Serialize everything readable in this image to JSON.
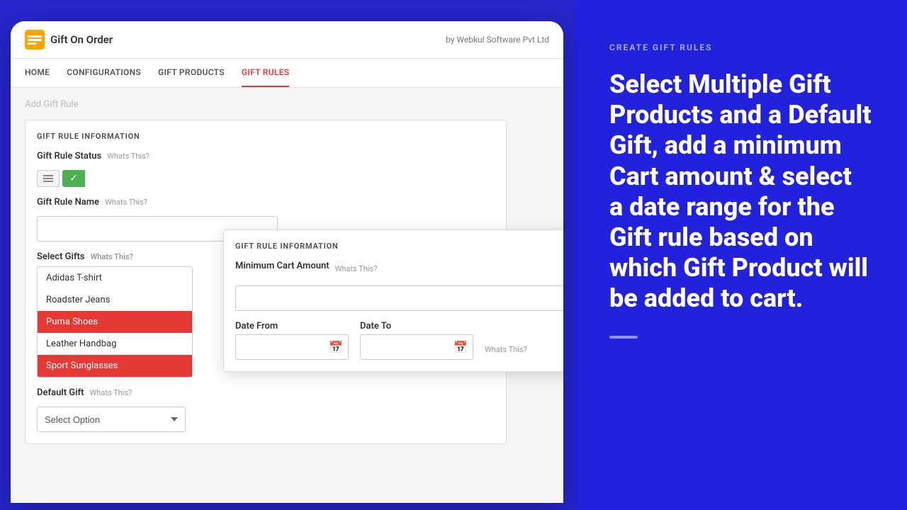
{
  "app": {
    "logo_text": "Gift On Order",
    "by_text": "by Webkul Software Pvt Ltd"
  },
  "nav": {
    "items": [
      {
        "label": "HOME",
        "active": false
      },
      {
        "label": "CONFIGURATIONS",
        "active": false
      },
      {
        "label": "GIFT PRODUCTS",
        "active": false
      },
      {
        "label": "GIFT RULES",
        "active": true
      }
    ]
  },
  "page": {
    "title": "Add Gift Rule",
    "section_title": "GIFT RULE INFORMATION",
    "gift_rule_status_label": "Gift Rule Status",
    "whats_this": "Whats This?",
    "gift_rule_name_label": "Gift Rule Name",
    "select_gifts_label": "Select Gifts",
    "select_gifts_whats": "Whats This?",
    "default_gift_label": "Default Gift",
    "default_gift_whats": "Whats This?",
    "select_option_placeholder": "Select Option"
  },
  "gift_items": [
    {
      "label": "Adidas T-shirt",
      "selected": false
    },
    {
      "label": "Roadster Jeans",
      "selected": false
    },
    {
      "label": "Puma Shoes",
      "selected": true
    },
    {
      "label": "Leather Handbag",
      "selected": false
    },
    {
      "label": "Sport Sunglasses",
      "selected": true
    }
  ],
  "second_panel": {
    "section_title": "GIFT RULE INFORMATION",
    "min_cart_label": "Minimum Cart Amount",
    "min_cart_whats": "Whats This?",
    "date_from_label": "Date From",
    "date_to_label": "Date To",
    "date_whats": "Whats This?"
  },
  "right_panel": {
    "create_label": "CREATE GIFT RULES",
    "promo_text": "Select Multiple Gift Products and a Default Gift, add a minimum Cart amount & select a date range for the Gift rule based on which Gift Product will be added to cart."
  },
  "colors": {
    "accent": "#e53935",
    "background": "#2626cc",
    "selected_item": "#e53935"
  }
}
